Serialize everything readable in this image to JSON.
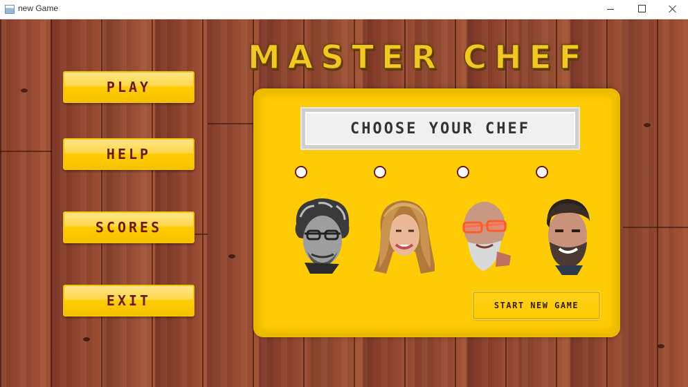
{
  "window": {
    "title": "new Game",
    "icon": "app-window-icon"
  },
  "game": {
    "title": "MASTER CHEF",
    "menu": [
      {
        "label": "PLAY"
      },
      {
        "label": "HELP"
      },
      {
        "label": "SCORES"
      },
      {
        "label": "EXIT"
      }
    ],
    "panel": {
      "heading": "CHOOSE YOUR CHEF",
      "chefs": [
        {
          "selected": false,
          "portrait": "chef-1-grey-hair-glasses"
        },
        {
          "selected": false,
          "portrait": "chef-2-long-blonde-hair"
        },
        {
          "selected": false,
          "portrait": "chef-3-bald-orange-glasses"
        },
        {
          "selected": false,
          "portrait": "chef-4-dark-hair-beard"
        }
      ],
      "start_label": "START NEW GAME"
    }
  },
  "colors": {
    "button_yellow": "#ffcc00",
    "button_text": "#6b1b0c",
    "panel": "#ffcb05",
    "title": "#f3c724"
  }
}
